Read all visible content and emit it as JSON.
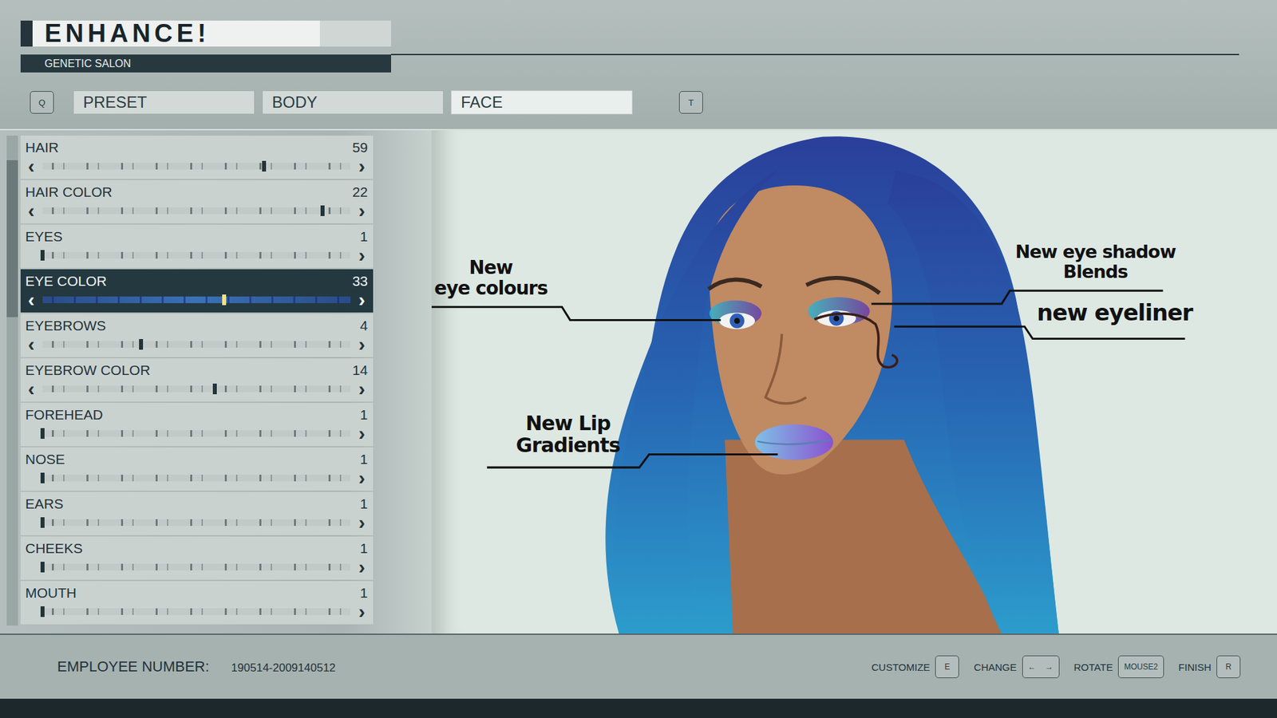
{
  "header": {
    "logo": "ENHANCE!",
    "subtitle": "GENETIC SALON"
  },
  "tabs": {
    "prev_key": "Q",
    "next_key": "T",
    "items": [
      {
        "label": "PRESET",
        "selected": false
      },
      {
        "label": "BODY",
        "selected": false
      },
      {
        "label": "FACE",
        "selected": true
      }
    ]
  },
  "slider_arrows": {
    "prev": "‹",
    "next": "›"
  },
  "scrollbar": {
    "start": 0.05,
    "share": 0.32
  },
  "sliders": [
    {
      "label": "HAIR",
      "value": "59",
      "level": 0.72,
      "selected": false,
      "prev_enabled": true
    },
    {
      "label": "HAIR COLOR",
      "value": "22",
      "level": 0.91,
      "selected": false,
      "prev_enabled": true
    },
    {
      "label": "EYES",
      "value": "1",
      "level": 0.0,
      "selected": false,
      "prev_enabled": false
    },
    {
      "label": "EYE COLOR",
      "value": "33",
      "level": 0.59,
      "selected": true,
      "prev_enabled": true
    },
    {
      "label": "EYEBROWS",
      "value": "4",
      "level": 0.32,
      "selected": false,
      "prev_enabled": true
    },
    {
      "label": "EYEBROW COLOR",
      "value": "14",
      "level": 0.56,
      "selected": false,
      "prev_enabled": true
    },
    {
      "label": "FOREHEAD",
      "value": "1",
      "level": 0.0,
      "selected": false,
      "prev_enabled": false
    },
    {
      "label": "NOSE",
      "value": "1",
      "level": 0.0,
      "selected": false,
      "prev_enabled": false
    },
    {
      "label": "EARS",
      "value": "1",
      "level": 0.0,
      "selected": false,
      "prev_enabled": false
    },
    {
      "label": "CHEEKS",
      "value": "1",
      "level": 0.0,
      "selected": false,
      "prev_enabled": false
    },
    {
      "label": "MOUTH",
      "value": "1",
      "level": 0.0,
      "selected": false,
      "prev_enabled": false
    }
  ],
  "annotations": [
    {
      "lines": [
        "New",
        "eye colours"
      ]
    },
    {
      "lines": [
        "New eye shadow",
        "Blends"
      ]
    },
    {
      "lines": [
        "new eyeliner"
      ]
    },
    {
      "lines": [
        "New Lip",
        "Gradients"
      ]
    }
  ],
  "footer": {
    "employee_label": "EMPLOYEE NUMBER:",
    "employee_number": "190514-2009140512",
    "controls": [
      {
        "label": "CUSTOMIZE",
        "keys": [
          "E"
        ]
      },
      {
        "label": "CHANGE",
        "keys": [
          "←",
          "→"
        ]
      },
      {
        "label": "ROTATE",
        "keys": [
          "MOUSE2"
        ]
      },
      {
        "label": "FINISH",
        "keys": [
          "R"
        ]
      }
    ]
  }
}
